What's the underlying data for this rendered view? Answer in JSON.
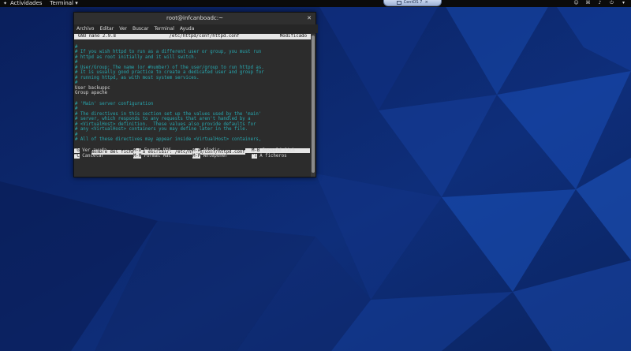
{
  "topbar": {
    "activities": "Actividades",
    "app_menu": "Terminal ▾",
    "vm_tab": "CentOS 7"
  },
  "window": {
    "title": "root@infcanboadc:~",
    "menu": [
      "Archivo",
      "Editar",
      "Ver",
      "Buscar",
      "Terminal",
      "Ayuda"
    ]
  },
  "nano": {
    "header": {
      "version": "GNU nano 2.9.8",
      "file": "/etc/httpd/conf/httpd.conf",
      "status": "Modificado"
    },
    "lines": [
      {
        "text": "#",
        "type": "comment"
      },
      {
        "text": "# If you wish httpd to run as a different user or group, you must run",
        "type": "comment"
      },
      {
        "text": "# httpd as root initially and it will switch.",
        "type": "comment"
      },
      {
        "text": "#",
        "type": "comment"
      },
      {
        "text": "# User/Group: The name (or #number) of the user/group to run httpd as.",
        "type": "comment"
      },
      {
        "text": "# It is usually good practice to create a dedicated user and group for",
        "type": "comment"
      },
      {
        "text": "# running httpd, as with most system services.",
        "type": "comment"
      },
      {
        "text": "#",
        "type": "comment"
      },
      {
        "text": "User backuppc",
        "type": "normal"
      },
      {
        "text": "Group apache",
        "type": "normal"
      },
      {
        "text": "",
        "type": "normal"
      },
      {
        "text": "# 'Main' server configuration",
        "type": "comment"
      },
      {
        "text": "#",
        "type": "comment"
      },
      {
        "text": "# The directives in this section set up the values used by the 'main'",
        "type": "comment"
      },
      {
        "text": "# server, which responds to any requests that aren't handled by a",
        "type": "comment"
      },
      {
        "text": "# <VirtualHost> definition.  These values also provide defaults for",
        "type": "comment"
      },
      {
        "text": "# any <VirtualHost> containers you may define later in the file.",
        "type": "comment"
      },
      {
        "text": "#",
        "type": "comment"
      },
      {
        "text": "# All of these directives may appear inside <VirtualHost> containers,",
        "type": "comment"
      }
    ],
    "prompt": "Nombre del fichero a escribir: /etc/httpd/conf/httpd.conf",
    "shortcuts_row1": [
      {
        "key": "^G",
        "label": "Ver ayuda"
      },
      {
        "key": "M-D",
        "label": "Format DOS"
      },
      {
        "key": "M-A",
        "label": "Añadir"
      },
      {
        "key": "M-B",
        "label": "Respald fich"
      }
    ],
    "shortcuts_row2": [
      {
        "key": "^C",
        "label": "Cancelar"
      },
      {
        "key": "M-M",
        "label": "Format Mac"
      },
      {
        "key": "M-P",
        "label": "Anteponer"
      },
      {
        "key": "^T",
        "label": "A ficheros"
      }
    ]
  },
  "colors": {
    "desktop": "#081a4a",
    "comment": "#27a8b0",
    "terminal_bg": "#2c2c2c"
  }
}
